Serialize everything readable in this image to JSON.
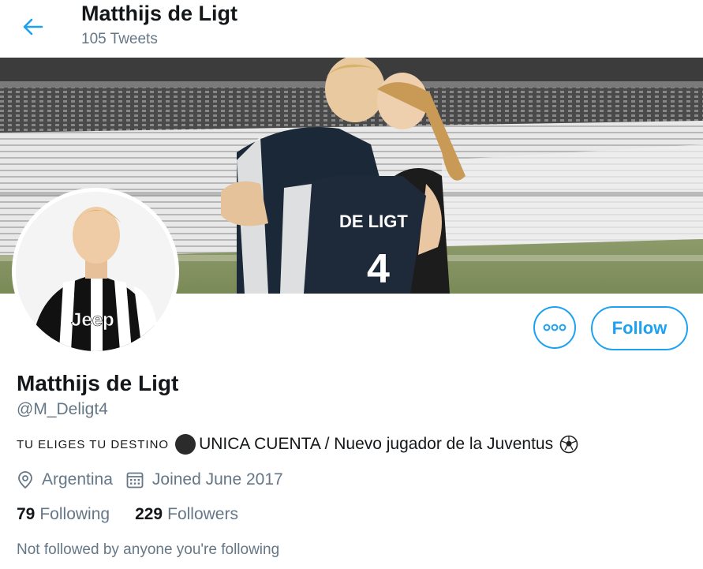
{
  "header": {
    "title": "Matthijs de Ligt",
    "tweet_count": "105 Tweets"
  },
  "profile": {
    "name": "Matthijs de Ligt",
    "handle": "@M_Deligt4",
    "bio_small_caps": "TU ELIGES TU DESTINO",
    "bio_main": "UNICA CUENTA /  Nuevo jugador de la Juventus",
    "location": "Argentina",
    "joined": "Joined June 2017",
    "following_count": "79",
    "following_label": "Following",
    "followers_count": "229",
    "followers_label": "Followers",
    "not_followed_text": "Not followed by anyone you're following"
  },
  "actions": {
    "follow_label": "Follow"
  },
  "banner": {
    "jersey_text": "DE LIGT"
  },
  "avatar": {
    "shirt_text": "Jeep"
  },
  "colors": {
    "accent": "#1da1f2",
    "text": "#14171a",
    "muted": "#657786"
  },
  "icons": {
    "back": "arrow-left-icon",
    "more": "more-dots-icon",
    "location": "location-pin-icon",
    "calendar": "calendar-icon",
    "soccer": "soccer-ball-icon"
  }
}
